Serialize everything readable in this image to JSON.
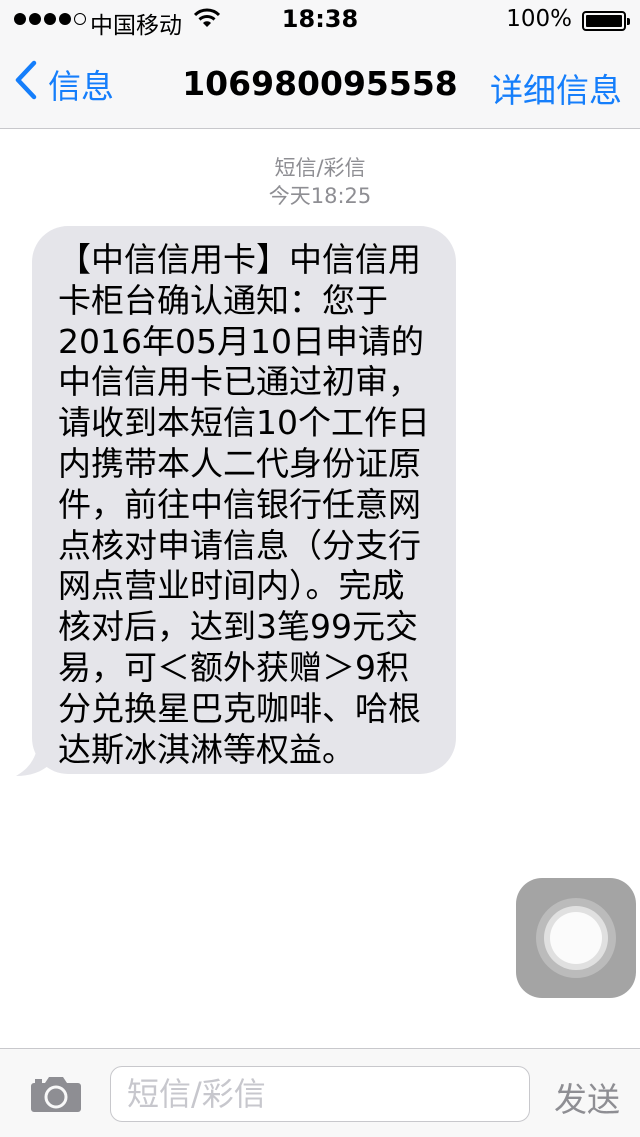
{
  "status_bar": {
    "carrier": "中国移动",
    "time": "18:38",
    "battery_percent": "100%",
    "signal_bars_filled": 4,
    "signal_bars_total": 5
  },
  "nav": {
    "back_label": "信息",
    "title": "106980095558",
    "details_label": "详细信息"
  },
  "thread": {
    "message_type": "短信/彩信",
    "timestamp": "今天18:25",
    "message_lines": [
      "【中信信用卡】中信信用",
      "卡柜台确认通知：您于",
      "2016年05月10日申请的",
      "中信信用卡已通过初审，",
      "请收到本短信10个工作日",
      "内携带本人二代身份证原",
      "件，前往中信银行任意网",
      "点核对申请信息（分支行",
      "网点营业时间内）。完成",
      "核对后，达到3笔99元交",
      "易，可＜额外获赠＞9积",
      "分兑换星巴克咖啡、哈根",
      "达斯冰淇淋等权益。"
    ]
  },
  "composer": {
    "placeholder": "短信/彩信",
    "value": "",
    "send_label": "发送"
  },
  "icons": {
    "back": "chevron-left-icon",
    "wifi": "wifi-icon",
    "battery": "battery-icon",
    "camera": "camera-icon",
    "assistive_touch": "assistive-touch-icon"
  },
  "colors": {
    "accent": "#157efb",
    "bubble": "#e5e5ea",
    "secondary_text": "#8e8e93"
  }
}
